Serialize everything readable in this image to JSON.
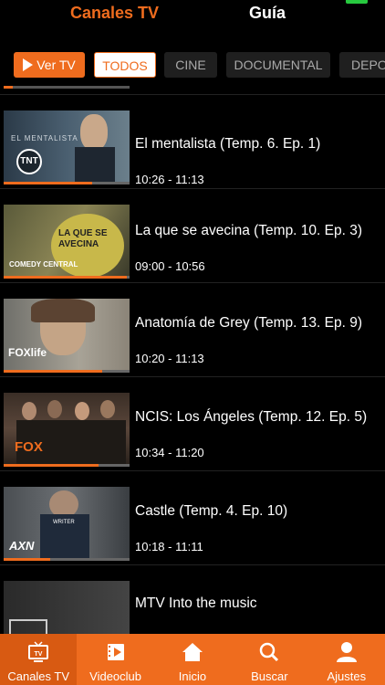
{
  "top_tabs": {
    "active": "Canales TV",
    "inactive": "Guía"
  },
  "filters": {
    "ver_tv": "Ver TV",
    "todos": "TODOS",
    "cine": "CINE",
    "documental": "DOCUMENTAL",
    "deportes": "DEPO"
  },
  "programs": [
    {
      "title": "El mentalista (Temp. 6. Ep. 1)",
      "time": "10:26 - 11:13",
      "channel": "TNT",
      "thumb_text": "EL MENTALISTA",
      "progress": 0.7
    },
    {
      "title": "La que se avecina (Temp. 10. Ep. 3)",
      "time": "09:00 - 10:56",
      "channel": "COMEDY CENTRAL",
      "thumb_text": "LA QUE SE AVECINA",
      "progress": 0.98
    },
    {
      "title": "Anatomía de Grey (Temp. 13. Ep. 9)",
      "time": "10:20 - 11:13",
      "channel": "FOXlife",
      "thumb_text": "",
      "progress": 0.78
    },
    {
      "title": "NCIS: Los Ángeles (Temp. 12. Ep. 5)",
      "time": "10:34 - 11:20",
      "channel": "FOX",
      "thumb_text": "",
      "progress": 0.75
    },
    {
      "title": "Castle (Temp. 4. Ep. 10)",
      "time": "10:18 - 11:11",
      "channel": "AXN",
      "thumb_text": "",
      "progress": 0.37
    },
    {
      "title": "MTV Into the music",
      "time": "",
      "channel": "",
      "thumb_text": "",
      "progress": 0.0
    }
  ],
  "tabbar": {
    "canales": "Canales TV",
    "videoclub": "Videoclub",
    "inicio": "Inicio",
    "buscar": "Buscar",
    "ajustes": "Ajustes"
  },
  "colors": {
    "accent": "#ef6c1e",
    "background": "#000000"
  }
}
